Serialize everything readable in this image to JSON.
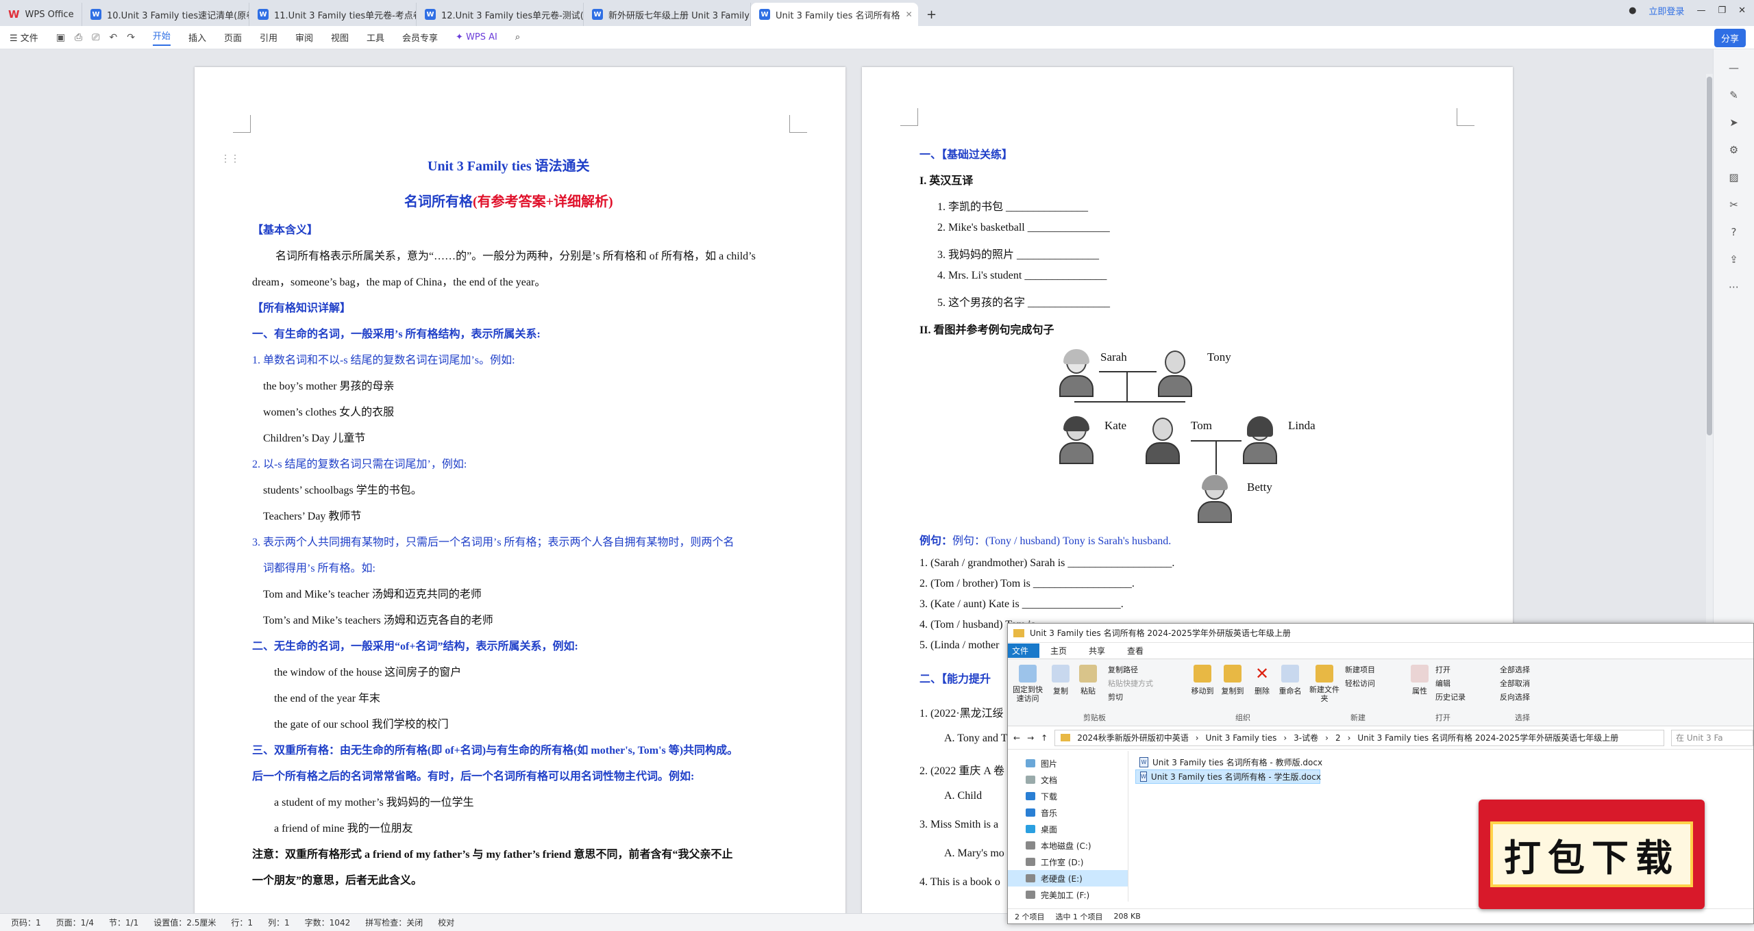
{
  "tabs": [
    {
      "label": "WPS Office",
      "type": "logo"
    },
    {
      "label": "10.Unit 3 Family ties速记清单(原卷..."
    },
    {
      "label": "11.Unit 3 Family ties单元卷-考点卷(..."
    },
    {
      "label": "12.Unit 3 Family ties单元卷-测试(..."
    },
    {
      "label": "新外研版七年级上册 Unit 3 Family ti..."
    },
    {
      "label": "Unit 3 Family ties 名词所有格"
    }
  ],
  "titlebar": {
    "login": "立即登录",
    "share": "分享"
  },
  "ribbon": {
    "file_menu": "文件",
    "menus": [
      "开始",
      "插入",
      "页面",
      "引用",
      "审阅",
      "视图",
      "工具",
      "会员专享"
    ],
    "wps_ai": "WPS AI"
  },
  "page1": {
    "title_a": "Unit 3 Family ties",
    "title_b": "语法通关",
    "subtitle_a": "名词所有格",
    "subtitle_b": "(有参考答案+详细解析)",
    "lines": [
      "【基本含义】",
      "名词所有格表示所属关系，意为“……的”。一般分为两种，分别是’s 所有格和 of 所有格，如 a child’s",
      "dream，someone’s bag，the map of China，the end of the year。",
      "【所有格知识详解】",
      "一、有生命的名词，一般采用’s 所有格结构，表示所属关系:",
      "1. 单数名词和不以-s 结尾的复数名词在词尾加’s。例如:",
      "the boy’s mother 男孩的母亲",
      "women’s clothes 女人的衣服",
      "Children’s Day  儿童节",
      "2. 以-s 结尾的复数名词只需在词尾加’，例如:",
      "students’ schoolbags 学生的书包。",
      "Teachers’ Day  教师节",
      "3. 表示两个人共同拥有某物时，只需后一个名词用’s 所有格；表示两个人各自拥有某物时，则两个名",
      "词都得用’s 所有格。如:",
      "Tom and Mike’s teacher         汤姆和迈克共同的老师",
      "Tom’s and Mike’s teachers      汤姆和迈克各自的老师",
      "二、无生命的名词，一般采用“of+名词”结构，表示所属关系，例如:",
      "the window of the house     这间房子的窗户",
      "the end of the year       年末",
      "the gate of our school     我们学校的校门",
      "三、双重所有格：由无生命的所有格(即 of+名词)与有生命的所有格(如 mother's, Tom's 等)共同构成。",
      "后一个所有格之后的名词常常省略。有时，后一个名词所有格可以用名词性物主代词。例如:",
      "a student of my mother’s     我妈妈的一位学生",
      "a friend of mine  我的一位朋友",
      "注意：双重所有格形式 a friend of my father’s  与 my father’s friend 意思不同，前者含有“我父亲不止",
      "一个朋友”的意思，后者无此含义。"
    ]
  },
  "page2": {
    "lines": [
      "一、【基础过关练】",
      "I. 英汉互译",
      "1. 李凯的书包 _______________",
      "2. Mike's basketball _______________",
      "3. 我妈妈的照片 _______________",
      "4. Mrs. Li's student _______________",
      "5. 这个男孩的名字 _______________",
      "II. 看图并参考例句完成句子",
      "例句：(Tony / husband) Tony is Sarah's husband.",
      "1. (Sarah / grandmother) Sarah is ___________________.",
      "2. (Tom / brother) Tom is __________________.",
      "3. (Kate / aunt) Kate is __________________.",
      "4. (Tom / husband) Tom is",
      "5. (Linda / mother",
      "二、【能力提升",
      "1. (2022·黑龙江绥",
      "A. Tony and T",
      "2. (2022 重庆 A 卷",
      "A. Child",
      "3. Miss Smith is a",
      "A. Mary's mo",
      "4. This is a book o"
    ],
    "family": [
      "Sarah",
      "Tony",
      "Kate",
      "Tom",
      "Linda",
      "Betty"
    ]
  },
  "statusbar": [
    "页码：1",
    "页面：1/4",
    "节：1/1",
    "设置值：2.5厘米",
    "行：1",
    "列：1",
    "字数：1042",
    "拼写检查：关闭",
    "校对"
  ],
  "explorer": {
    "title": "Unit 3 Family ties 名词所有格 2024-2025学年外研版英语七年级上册",
    "tabs": [
      "文件",
      "主页",
      "共享",
      "查看"
    ],
    "ribbon": {
      "pin": "固定到快速访问",
      "copy": "复制",
      "paste": "粘贴",
      "copy_path": "复制路径",
      "paste_shortcut": "粘贴快捷方式",
      "cut": "剪切",
      "clipboard": "剪贴板",
      "move_to": "移动到",
      "copy_to": "复制到",
      "delete": "删除",
      "rename": "重命名",
      "organize": "组织",
      "new_folder": "新建文件夹",
      "new_item": "新建项目",
      "easy_access": "轻松访问",
      "new": "新建",
      "properties": "属性",
      "open": "打开",
      "edit": "编辑",
      "history": "历史记录",
      "open_group": "打开",
      "select_all": "全部选择",
      "select_none": "全部取消",
      "invert": "反向选择",
      "select": "选择"
    },
    "path": [
      "2024秋季新版外研版初中英语",
      "Unit 3 Family ties",
      "3-试卷",
      "2",
      "Unit 3 Family ties 名词所有格 2024-2025学年外研版英语七年级上册"
    ],
    "search": "在 Unit 3 Fa",
    "nav": [
      "图片",
      "文档",
      "下载",
      "音乐",
      "桌面",
      "本地磁盘 (C:)",
      "工作室 (D:)",
      "老硬盘 (E:)",
      "完美加工 (F:)"
    ],
    "files": [
      "Unit 3 Family ties 名词所有格 - 教师版.docx",
      "Unit 3 Family ties 名词所有格 - 学生版.docx"
    ],
    "status": [
      "2 个项目",
      "选中 1 个项目",
      "208 KB"
    ]
  },
  "badge": "打包下载",
  "colors": {
    "accent": "#2f6fe4",
    "heading_blue": "#1f3fc8",
    "red": "#e0102a",
    "badge": "#d8192a"
  }
}
